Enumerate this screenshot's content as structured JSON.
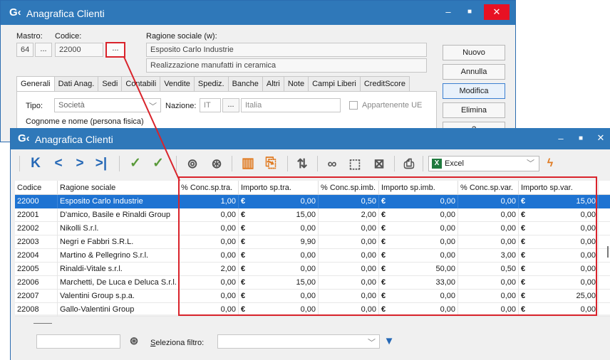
{
  "back_window": {
    "logo": "G‹",
    "title": "Anagrafica Clienti",
    "controls": {
      "minimize": "–",
      "maximize": "■",
      "close": "✕"
    },
    "mastro_label": "Mastro:",
    "codice_label": "Codice:",
    "ragione_label": "Ragione sociale (w):",
    "mastro_value": "64",
    "codice_value": "22000",
    "ellipsis": "...",
    "ragione_value": "Esposito Carlo Industrie",
    "descrizione_value": "Realizzazione manufatti in ceramica",
    "buttons": {
      "nuovo": "Nuovo",
      "annulla": "Annulla",
      "modifica": "Modifica",
      "elimina": "Elimina",
      "partial": "?"
    },
    "tabs": [
      "Generali",
      "Dati Anag.",
      "Sedi",
      "Contabili",
      "Vendite",
      "Spediz.",
      "Banche",
      "Altri",
      "Note",
      "Campi Liberi",
      "CreditScore"
    ],
    "tipo_label": "Tipo:",
    "tipo_value": "Società",
    "nazione_label": "Nazione:",
    "nazione_code": "IT",
    "nazione_value": "Italia",
    "appartenente_ue": "Appartenente UE",
    "cognome_label": "Cognome e nome (persona fisica)"
  },
  "front_window": {
    "logo": "G‹",
    "title": "Anagrafica Clienti",
    "controls": {
      "minimize": "–",
      "maximize": "■",
      "close": "✕"
    },
    "toolbar": {
      "icons": [
        "first-record-icon",
        "previous-record-icon",
        "next-record-icon",
        "last-record-icon",
        "confirm-icon",
        "confirm-all-icon",
        "search-icon",
        "advanced-search-icon",
        "columns-icon",
        "export-doc-icon",
        "sort-icon",
        "link-icon",
        "select-icon",
        "delete-selection-icon",
        "print-icon",
        "excel-icon",
        "lightning-icon"
      ],
      "export_label": "Excel"
    },
    "grid": {
      "columns": [
        "Codice",
        "Ragione sociale",
        "% Conc.sp.tra.",
        "Importo sp.tra.",
        "% Conc.sp.imb.",
        "Importo sp.imb.",
        "% Conc.sp.var.",
        "Importo sp.var."
      ],
      "currency": "€",
      "rows": [
        {
          "codice": "22000",
          "ragione": "Esposito Carlo Industrie",
          "pct_tra": "1,00",
          "imp_tra": "0,00",
          "pct_imb": "0,50",
          "imp_imb": "0,00",
          "pct_var": "0,00",
          "imp_var": "15,00"
        },
        {
          "codice": "22001",
          "ragione": "D'amico, Basile e Rinaldi Group",
          "pct_tra": "0,00",
          "imp_tra": "15,00",
          "pct_imb": "2,00",
          "imp_imb": "0,00",
          "pct_var": "0,00",
          "imp_var": "0,00"
        },
        {
          "codice": "22002",
          "ragione": "Nikolli S.r.l.",
          "pct_tra": "0,00",
          "imp_tra": "0,00",
          "pct_imb": "0,00",
          "imp_imb": "0,00",
          "pct_var": "0,00",
          "imp_var": "0,00"
        },
        {
          "codice": "22003",
          "ragione": "Negri e Fabbri S.R.L.",
          "pct_tra": "0,00",
          "imp_tra": "9,90",
          "pct_imb": "0,00",
          "imp_imb": "0,00",
          "pct_var": "0,00",
          "imp_var": "0,00"
        },
        {
          "codice": "22004",
          "ragione": "Martino & Pellegrino S.r.l.",
          "pct_tra": "0,00",
          "imp_tra": "0,00",
          "pct_imb": "0,00",
          "imp_imb": "0,00",
          "pct_var": "3,00",
          "imp_var": "0,00"
        },
        {
          "codice": "22005",
          "ragione": "Rinaldi-Vitale s.r.l.",
          "pct_tra": "2,00",
          "imp_tra": "0,00",
          "pct_imb": "0,00",
          "imp_imb": "50,00",
          "pct_var": "0,50",
          "imp_var": "0,00"
        },
        {
          "codice": "22006",
          "ragione": "Marchetti, De Luca e Deluca S.r.l.",
          "pct_tra": "0,00",
          "imp_tra": "15,00",
          "pct_imb": "0,00",
          "imp_imb": "33,00",
          "pct_var": "0,00",
          "imp_var": "0,00"
        },
        {
          "codice": "22007",
          "ragione": "Valentini Group s.p.a.",
          "pct_tra": "0,00",
          "imp_tra": "0,00",
          "pct_imb": "0,00",
          "imp_imb": "0,00",
          "pct_var": "0,00",
          "imp_var": "25,00"
        },
        {
          "codice": "22008",
          "ragione": "Gallo-Valentini Group",
          "pct_tra": "0,00",
          "imp_tra": "0,00",
          "pct_imb": "0,00",
          "imp_imb": "0,00",
          "pct_var": "0,00",
          "imp_var": "0,00"
        }
      ]
    },
    "footer": {
      "search_value": "",
      "filtro_label": "Seleziona filtro:",
      "filtro_value": ""
    }
  }
}
